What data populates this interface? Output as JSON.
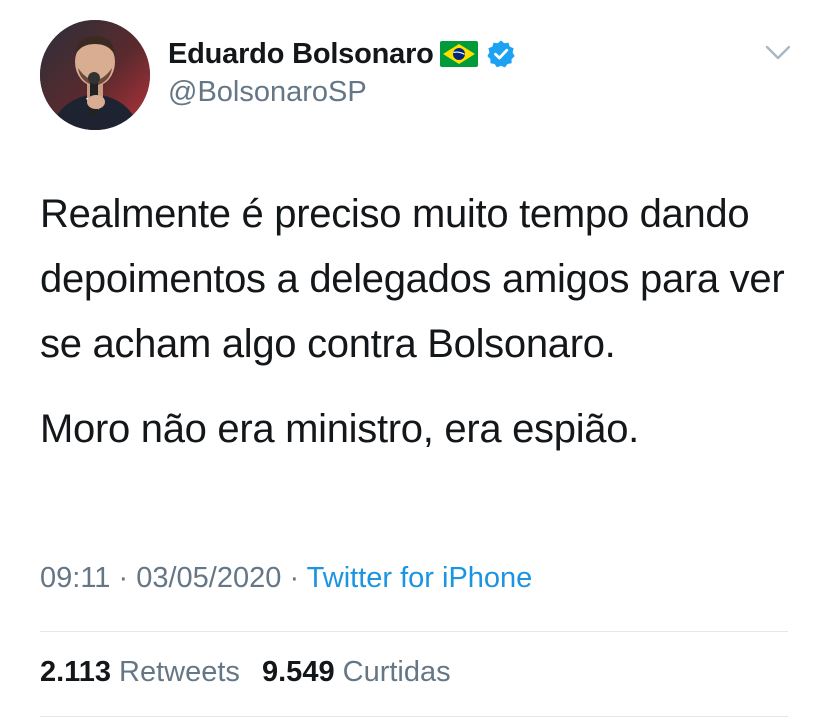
{
  "author": {
    "display_name": "Eduardo Bolsonaro",
    "handle": "@BolsonaroSP",
    "verified": true
  },
  "tweet": {
    "paragraphs": [
      "Realmente é preciso muito tempo dando depoimentos a delegados amigos para ver se acham algo contra Bolsonaro.",
      "Moro não era ministro, era espião."
    ]
  },
  "meta": {
    "time": "09:11",
    "separator_1": "·",
    "date": "03/05/2020",
    "separator_2": "·",
    "source": "Twitter for iPhone"
  },
  "stats": {
    "retweets_count": "2.113",
    "retweets_label": "Retweets",
    "likes_count": "9.549",
    "likes_label": "Curtidas"
  },
  "icons": {
    "flag": "brazil-flag-icon",
    "verified": "verified-badge-icon",
    "menu": "chevron-down-icon"
  },
  "colors": {
    "text_primary": "#14171a",
    "text_secondary": "#657786",
    "link": "#1b95e0",
    "verified": "#1da1f2",
    "divider": "#e1e8ed"
  }
}
